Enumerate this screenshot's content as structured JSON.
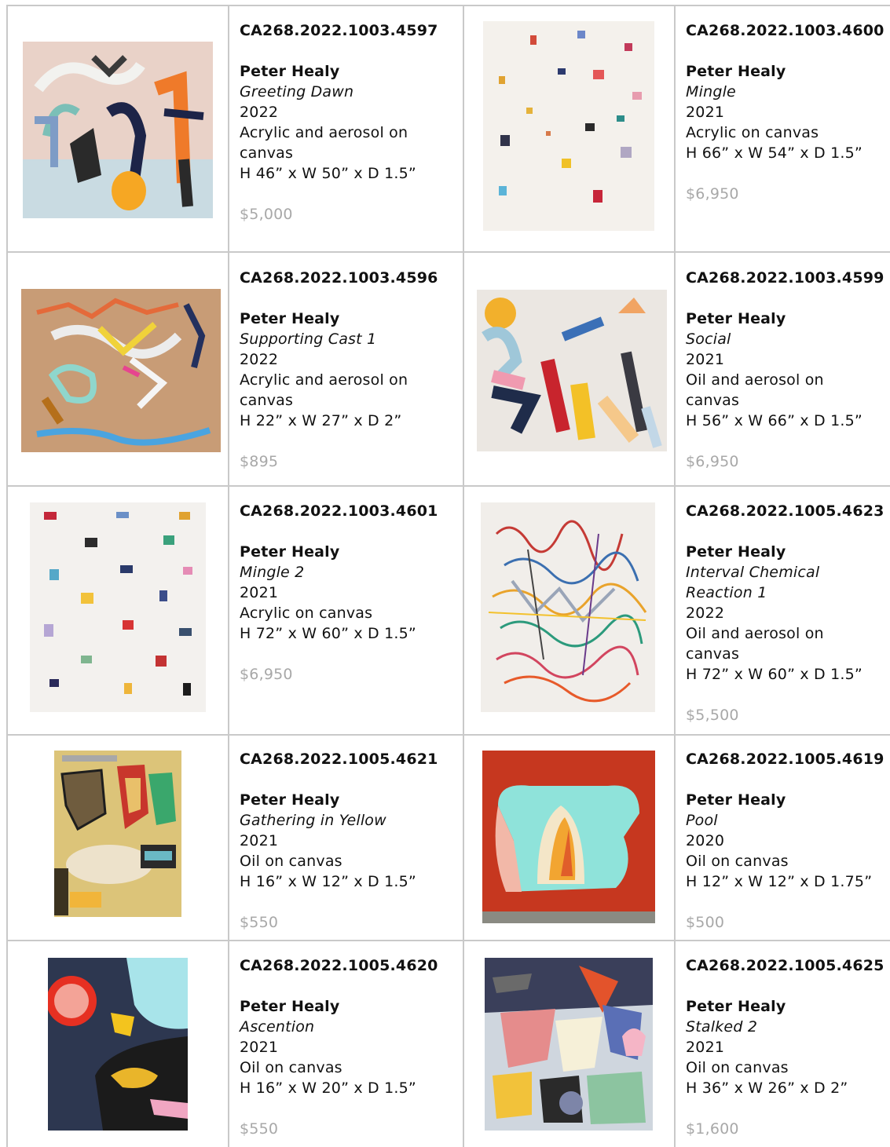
{
  "artworks": [
    {
      "code": "CA268.2022.1003.4597",
      "artist": "Peter Healy",
      "title": "Greeting Dawn",
      "year": "2022",
      "medium": "Acrylic and aerosol on canvas",
      "dimensions": "H 46” x W 50” x D 1.5”",
      "price": "$5,000"
    },
    {
      "code": "CA268.2022.1003.4600",
      "artist": "Peter Healy",
      "title": "Mingle",
      "year": "2021",
      "medium": "Acrylic on canvas",
      "dimensions": "H 66” x W 54” x D 1.5”",
      "price": "$6,950"
    },
    {
      "code": "CA268.2022.1003.4596",
      "artist": "Peter Healy",
      "title": "Supporting Cast 1",
      "year": "2022",
      "medium": "Acrylic and aerosol on canvas",
      "dimensions": "H 22” x W 27” x D 2”",
      "price": "$895"
    },
    {
      "code": "CA268.2022.1003.4599",
      "artist": "Peter Healy",
      "title": "Social",
      "year": "2021",
      "medium": "Oil and aerosol on canvas",
      "dimensions": "H 56” x W 66” x D 1.5”",
      "price": "$6,950"
    },
    {
      "code": "CA268.2022.1003.4601",
      "artist": "Peter Healy",
      "title": "Mingle 2",
      "year": "2021",
      "medium": "Acrylic on canvas",
      "dimensions": "H 72” x W 60” x D 1.5”",
      "price": "$6,950"
    },
    {
      "code": "CA268.2022.1005.4623",
      "artist": "Peter Healy",
      "title": "Interval Chemical Reaction 1",
      "year": "2022",
      "medium": "Oil and aerosol on canvas",
      "dimensions": "H 72” x W 60” x D 1.5”",
      "price": "$5,500"
    },
    {
      "code": "CA268.2022.1005.4621",
      "artist": "Peter Healy",
      "title": "Gathering in Yellow",
      "year": "2021",
      "medium": "Oil on canvas",
      "dimensions": "H 16” x W 12” x D 1.5”",
      "price": "$550"
    },
    {
      "code": "CA268.2022.1005.4619",
      "artist": "Peter Healy",
      "title": "Pool",
      "year": "2020",
      "medium": "Oil on canvas",
      "dimensions": "H 12” x W 12” x D 1.75”",
      "price": "$500"
    },
    {
      "code": "CA268.2022.1005.4620",
      "artist": "Peter Healy",
      "title": "Ascention",
      "year": "2021",
      "medium": "Oil on canvas",
      "dimensions": "H 16” x W 20” x D 1.5”",
      "price": "$550"
    },
    {
      "code": "CA268.2022.1005.4625",
      "artist": "Peter Healy",
      "title": "Stalked 2",
      "year": "2021",
      "medium": "Oil on canvas",
      "dimensions": "H 36” x W 26” x D 2”",
      "price": "$1,600"
    }
  ]
}
